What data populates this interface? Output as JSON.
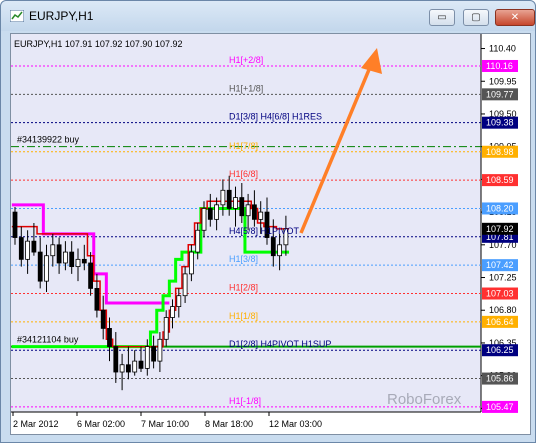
{
  "window": {
    "title": "EURJPY,H1",
    "buttons": {
      "minimize": "▭",
      "maximize": "▢",
      "close": "✕"
    }
  },
  "ohlc_header": "EURJPY,H1  107.91 107.92 107.90 107.92",
  "watermark": "RoboForex",
  "colors": {
    "plot_bg": "#e7e8f7",
    "grid": "#000000",
    "magenta": "#ff00ff",
    "red": "#e00000",
    "green": "#00ff00",
    "arrow": "#ff7f27"
  },
  "chart_data": {
    "type": "candlestick",
    "symbol": "EURJPY",
    "timeframe": "H1",
    "ohlc": {
      "open": 107.91,
      "high": 107.92,
      "low": 107.9,
      "close": 107.92
    },
    "ylim": [
      105.4,
      110.6
    ],
    "y_ticks": [
      "110.40",
      "109.95",
      "109.50",
      "109.05",
      "108.60",
      "108.15",
      "107.70",
      "107.25",
      "106.80",
      "106.35",
      "105.90",
      "105.45"
    ],
    "x_ticks": [
      "2 Mar 2012",
      "6 Mar 02:00",
      "7 Mar 10:00",
      "8 Mar 18:00",
      "12 Mar 03:00"
    ],
    "levels": [
      {
        "label": "H1[+2/8]",
        "value": 110.16,
        "value_label": "110.16",
        "color": "#ff00ff",
        "style": "dotted"
      },
      {
        "label": "H1[+1/8]",
        "value": 109.77,
        "value_label": "109.77",
        "color": "#555555",
        "style": "dotted"
      },
      {
        "label": "D1[3/8] H4[6/8] H1RES",
        "value": 109.38,
        "value_label": "109.38",
        "color": "#000080",
        "style": "dotted"
      },
      {
        "label": "",
        "value": 109.05,
        "value_label": "",
        "color": "#008000",
        "style": "dashdot"
      },
      {
        "label": "H1[7/8]",
        "value": 108.98,
        "value_label": "108.98",
        "color": "#ffb000",
        "style": "dotted"
      },
      {
        "label": "H1[6/8]",
        "value": 108.59,
        "value_label": "108.59",
        "color": "#ff3030",
        "style": "dotted"
      },
      {
        "label": "",
        "value": 108.2,
        "value_label": "108.20",
        "color": "#4a9eff",
        "style": "dotted"
      },
      {
        "label": "H4[5/8] H1PIVOT",
        "value": 107.81,
        "value_label": "107.81",
        "color": "#000080",
        "style": "dotted"
      },
      {
        "label": "H1[3/8]",
        "value": 107.42,
        "value_label": "107.42",
        "color": "#4a9eff",
        "style": "dotted"
      },
      {
        "label": "H1[2/8]",
        "value": 107.03,
        "value_label": "107.03",
        "color": "#ff3030",
        "style": "dotted"
      },
      {
        "label": "H1[1/8]",
        "value": 106.64,
        "value_label": "106.64",
        "color": "#ffb000",
        "style": "dotted"
      },
      {
        "label": "D1[2/8] H4PIVOT H1SUP",
        "value": 106.25,
        "value_label": "106.25",
        "color": "#000080",
        "style": "dotted"
      },
      {
        "label": "",
        "value": 105.86,
        "value_label": "105.86",
        "color": "#555555",
        "style": "dotted"
      },
      {
        "label": "H1[-1/8]",
        "value": 105.47,
        "value_label": "105.47",
        "color": "#ff00ff",
        "style": "dotted"
      }
    ],
    "orders": [
      {
        "label": "#34139922 buy",
        "value": 109.05
      },
      {
        "label": "#34121104 buy",
        "value": 106.3
      }
    ],
    "current_price": {
      "label": "107.92",
      "value": 107.92
    },
    "candles": [
      [
        108.15,
        108.22,
        107.7,
        107.8
      ],
      [
        107.8,
        107.95,
        107.4,
        107.5
      ],
      [
        107.5,
        107.9,
        107.3,
        107.75
      ],
      [
        107.75,
        108.0,
        107.55,
        107.6
      ],
      [
        107.6,
        107.8,
        107.1,
        107.2
      ],
      [
        107.2,
        107.7,
        107.05,
        107.55
      ],
      [
        107.55,
        107.85,
        107.4,
        107.7
      ],
      [
        107.7,
        107.8,
        107.3,
        107.45
      ],
      [
        107.45,
        107.75,
        107.35,
        107.6
      ],
      [
        107.6,
        107.75,
        107.3,
        107.4
      ],
      [
        107.4,
        107.65,
        107.2,
        107.5
      ],
      [
        107.5,
        107.7,
        107.35,
        107.45
      ],
      [
        107.45,
        107.6,
        107.0,
        107.1
      ],
      [
        107.1,
        107.3,
        106.7,
        106.8
      ],
      [
        106.8,
        107.0,
        106.4,
        106.55
      ],
      [
        106.55,
        106.7,
        106.1,
        106.3
      ],
      [
        106.3,
        106.5,
        105.8,
        105.95
      ],
      [
        105.95,
        106.2,
        105.7,
        106.05
      ],
      [
        106.05,
        106.3,
        105.85,
        105.95
      ],
      [
        105.95,
        106.25,
        105.9,
        106.1
      ],
      [
        106.1,
        106.3,
        105.95,
        106.0
      ],
      [
        106.0,
        106.4,
        105.9,
        106.3
      ],
      [
        106.3,
        106.45,
        106.0,
        106.1
      ],
      [
        106.1,
        106.5,
        105.95,
        106.4
      ],
      [
        106.4,
        106.8,
        106.3,
        106.7
      ],
      [
        106.7,
        106.95,
        106.55,
        106.85
      ],
      [
        106.85,
        107.1,
        106.7,
        107.0
      ],
      [
        107.0,
        107.4,
        106.9,
        107.3
      ],
      [
        107.3,
        107.7,
        107.2,
        107.6
      ],
      [
        107.6,
        108.0,
        107.5,
        107.9
      ],
      [
        107.9,
        108.3,
        107.8,
        108.2
      ],
      [
        108.2,
        108.4,
        107.95,
        108.05
      ],
      [
        108.05,
        108.35,
        107.9,
        108.25
      ],
      [
        108.25,
        108.6,
        108.1,
        108.45
      ],
      [
        108.45,
        108.65,
        108.1,
        108.2
      ],
      [
        108.2,
        108.5,
        107.95,
        108.35
      ],
      [
        108.35,
        108.55,
        108.0,
        108.1
      ],
      [
        108.1,
        108.4,
        107.9,
        108.25
      ],
      [
        108.25,
        108.45,
        107.95,
        108.05
      ],
      [
        108.05,
        108.3,
        107.85,
        108.15
      ],
      [
        108.15,
        108.35,
        107.7,
        107.8
      ],
      [
        107.8,
        108.05,
        107.4,
        107.55
      ],
      [
        107.55,
        107.85,
        107.35,
        107.7
      ],
      [
        107.7,
        108.1,
        107.55,
        107.92
      ]
    ],
    "lines": {
      "magenta": [
        108.25,
        108.25,
        108.25,
        108.25,
        108.25,
        107.85,
        107.85,
        107.85,
        107.85,
        107.85,
        107.85,
        107.85,
        107.85,
        107.3,
        107.3,
        106.9,
        106.9,
        106.9,
        106.9,
        106.9,
        106.9,
        106.9,
        106.9,
        106.9,
        106.9
      ],
      "red": [
        107.95,
        107.95,
        107.95,
        107.95,
        107.85,
        107.85,
        107.85,
        107.85,
        107.85,
        107.85,
        107.85,
        107.85,
        107.55,
        107.2,
        106.8,
        106.4,
        106.3,
        106.3,
        106.3,
        106.3,
        106.3,
        106.3,
        106.3,
        106.3,
        106.5,
        106.8,
        107.1,
        107.4,
        107.7,
        108.0,
        108.2,
        108.3,
        108.3,
        108.3,
        108.3,
        108.3,
        108.3,
        108.3,
        108.2,
        108.0,
        107.95,
        107.95,
        107.92,
        107.92
      ],
      "green": [
        106.3,
        106.3,
        106.3,
        106.3,
        106.3,
        106.3,
        106.3,
        106.3,
        106.3,
        106.3,
        106.3,
        106.3,
        106.3,
        106.3,
        106.3,
        106.3,
        106.3,
        106.3,
        106.3,
        106.3,
        106.3,
        106.3,
        106.5,
        106.8,
        107.0,
        107.2,
        107.5,
        107.6,
        107.6,
        107.6,
        108.2,
        108.2,
        108.2,
        108.2,
        108.2,
        108.2,
        108.2,
        107.6,
        107.6,
        107.6,
        107.6,
        107.6,
        107.6,
        107.6
      ]
    }
  }
}
